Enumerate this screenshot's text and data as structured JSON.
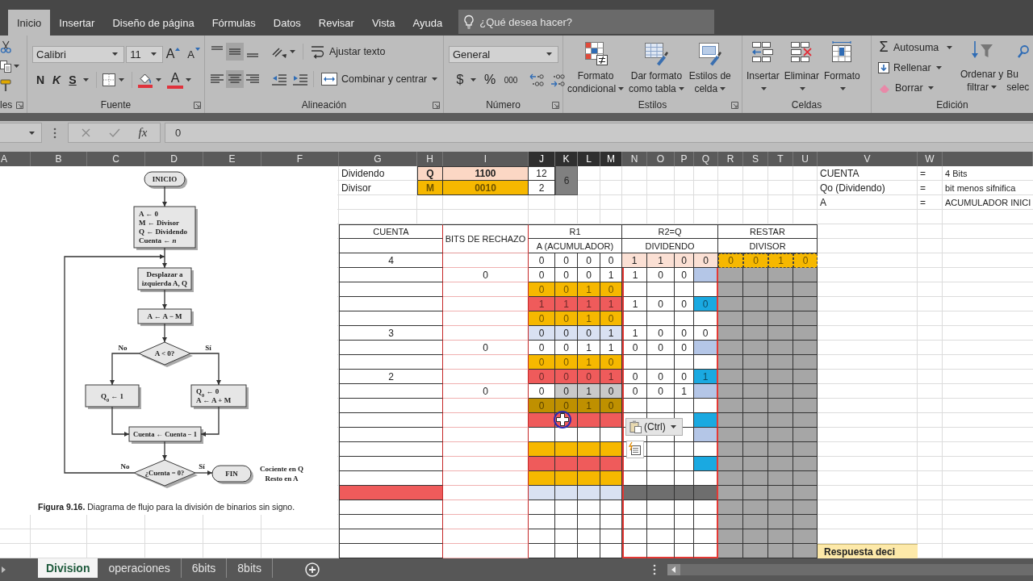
{
  "ribbon_tabs": [
    {
      "label": "Inicio",
      "selected": true
    },
    {
      "label": "Insertar",
      "selected": false
    },
    {
      "label": "Diseño de página",
      "selected": false
    },
    {
      "label": "Fórmulas",
      "selected": false
    },
    {
      "label": "Datos",
      "selected": false
    },
    {
      "label": "Revisar",
      "selected": false
    },
    {
      "label": "Vista",
      "selected": false
    },
    {
      "label": "Ayuda",
      "selected": false
    }
  ],
  "tell_me": {
    "placeholder": "¿Qué desea hacer?"
  },
  "ribbon": {
    "clipboard": {
      "label": "les"
    },
    "font": {
      "label": "Fuente",
      "font_name": "Calibri",
      "font_size": "11",
      "grow": "A",
      "shrink": "A",
      "bold": "N",
      "italic": "K",
      "underline": "S",
      "font_color": "A"
    },
    "alignment": {
      "label": "Alineación",
      "vertical": [
        {
          "selected": false
        },
        {
          "selected": true
        },
        {
          "selected": false
        }
      ],
      "horizontal": [
        {
          "selected": false
        },
        {
          "selected": true
        },
        {
          "selected": false
        }
      ],
      "wrap_text": "Ajustar texto",
      "merge": "Combinar y centrar"
    },
    "number": {
      "label": "Número",
      "format": "General",
      "currency": "$",
      "percent": "%",
      "thousands": "000"
    },
    "styles": {
      "label": "Estilos",
      "buttons": [
        [
          "Formato",
          "condicional"
        ],
        [
          "Dar formato",
          "como tabla"
        ],
        [
          "Estilos de",
          "celda"
        ]
      ]
    },
    "cells": {
      "label": "Celdas",
      "buttons": [
        "Insertar",
        "Eliminar",
        "Formato"
      ]
    },
    "editing": {
      "label": "Edición",
      "sigma": "Σ",
      "autosum": "Autosuma",
      "fill": "Rellenar",
      "clear": "Borrar",
      "sort": [
        "Ordenar y",
        "filtrar"
      ],
      "find": [
        "Bu",
        "selec"
      ]
    }
  },
  "formula_bar": {
    "fx": "fx",
    "value": "0"
  },
  "columns": [
    {
      "label": "A",
      "selected": false
    },
    {
      "label": "B",
      "selected": false
    },
    {
      "label": "C",
      "selected": false
    },
    {
      "label": "D",
      "selected": false
    },
    {
      "label": "E",
      "selected": false
    },
    {
      "label": "F",
      "selected": false
    },
    {
      "label": "G",
      "selected": false
    },
    {
      "label": "H",
      "selected": false
    },
    {
      "label": "I",
      "selected": false
    },
    {
      "label": "J",
      "selected": true
    },
    {
      "label": "K",
      "selected": true
    },
    {
      "label": "L",
      "selected": true
    },
    {
      "label": "M",
      "selected": true
    },
    {
      "label": "N",
      "selected": false
    },
    {
      "label": "O",
      "selected": false
    },
    {
      "label": "P",
      "selected": false
    },
    {
      "label": "Q",
      "selected": false
    },
    {
      "label": "R",
      "selected": false
    },
    {
      "label": "S",
      "selected": false
    },
    {
      "label": "T",
      "selected": false
    },
    {
      "label": "U",
      "selected": false
    },
    {
      "label": "V",
      "selected": false
    },
    {
      "label": "W",
      "selected": false
    }
  ],
  "flowchart": {
    "start": "INICIO",
    "init": [
      "A ← 0",
      "M ← Divisor",
      "Q ← Dividendo",
      "Cuenta ← *n*"
    ],
    "shift": [
      "Desplazar a",
      "izquierda A, Q"
    ],
    "subtract": "A ← A − M",
    "test": "A < 0?",
    "test_no": "No",
    "test_yes": "Sí",
    "set_one": "Q$_{0}$ ← 1",
    "restore": [
      "Q$_{0}$ ← 0",
      "A ← A + M"
    ],
    "decrement": "Cuenta ← Cuenta − 1",
    "loop_test": "¿Cuenta = 0?",
    "loop_no": "No",
    "loop_yes": "Sí",
    "end": "FIN",
    "result": [
      "Cociente en Q",
      "Resto en A"
    ],
    "caption": "**Figura 9.16.** Diagrama de flujo para la división de binarios sin signo."
  },
  "info": {
    "rows": [
      {
        "label": "Dividendo",
        "register": "Q",
        "binary": "1100",
        "decimal": "12",
        "color": "#fbd7c4"
      },
      {
        "label": "Divisor",
        "register": "M",
        "binary": "0010",
        "decimal": "2",
        "color": "#f6b800"
      }
    ],
    "quotient": "6"
  },
  "notes": [
    {
      "term": "CUENTA",
      "equals": "=",
      "meaning": "4 Bits"
    },
    {
      "term": "Qo (Dividendo)",
      "equals": "=",
      "meaning": "bit menos sifnifica"
    },
    {
      "term": "A",
      "equals": "=",
      "meaning": "ACUMULADOR INICI"
    }
  ],
  "table": {
    "cuenta": "CUENTA",
    "bits": "BITS DE RECHAZO",
    "r1": "R1",
    "r1_sub": "A (ACUMULADOR)",
    "r2": "R2=Q",
    "r2_sub": "DIVIDENDO",
    "restar": "RESTAR",
    "restar_sub": "DIVISOR",
    "restar_marquee": true,
    "rows": [
      {
        "cuenta": {
          "value": "4"
        },
        "a": [
          {
            "value": "0",
            "color": "#ffffff"
          },
          {
            "value": "0",
            "color": "#ffffff"
          },
          {
            "value": "0",
            "color": "#ffffff"
          },
          {
            "value": "0",
            "color": "#ffffff"
          }
        ],
        "q": [
          {
            "value": "1",
            "color": "#fbe0d4"
          },
          {
            "value": "1",
            "color": "#fbe0d4"
          },
          {
            "value": "0",
            "color": "#fbe0d4"
          },
          {
            "value": "0",
            "color": "#fbe0d4"
          }
        ],
        "m": [
          {
            "value": "0",
            "color": "#f6b800"
          },
          {
            "value": "0",
            "color": "#f6b800"
          },
          {
            "value": "1",
            "color": "#f6b800"
          },
          {
            "value": "0",
            "color": "#f6b800"
          }
        ]
      },
      {
        "bits": "0",
        "a": [
          {
            "value": "0",
            "color": "#ffffff"
          },
          {
            "value": "0",
            "color": "#ffffff"
          },
          {
            "value": "0",
            "color": "#ffffff"
          },
          {
            "value": "1",
            "color": "#ffffff"
          }
        ],
        "q": [
          {
            "value": "1",
            "color": "#ffffff"
          },
          {
            "value": "0",
            "color": "#ffffff"
          },
          {
            "value": "0",
            "color": "#ffffff"
          },
          {
            "color": "#b4c6e7"
          }
        ],
        "m": [
          {
            "color": "#a6a6a6"
          },
          {
            "color": "#a6a6a6"
          },
          {
            "color": "#a6a6a6"
          },
          {
            "color": "#a6a6a6"
          }
        ]
      },
      {
        "a": [
          {
            "value": "0",
            "color": "#f6b800"
          },
          {
            "value": "0",
            "color": "#f6b800"
          },
          {
            "value": "1",
            "color": "#f6b800"
          },
          {
            "value": "0",
            "color": "#f6b800"
          }
        ],
        "q": [
          {
            "color": "#ffffff"
          },
          {
            "color": "#ffffff"
          },
          {
            "color": "#ffffff"
          },
          {
            "color": "#ffffff"
          }
        ],
        "m": [
          {
            "color": "#a6a6a6"
          },
          {
            "color": "#a6a6a6"
          },
          {
            "color": "#a6a6a6"
          },
          {
            "color": "#a6a6a6"
          }
        ]
      },
      {
        "a": [
          {
            "value": "1",
            "color": "#ef5b5b"
          },
          {
            "value": "1",
            "color": "#ef5b5b"
          },
          {
            "value": "1",
            "color": "#ef5b5b"
          },
          {
            "value": "1",
            "color": "#ef5b5b"
          }
        ],
        "q": [
          {
            "value": "1",
            "color": "#ffffff"
          },
          {
            "value": "0",
            "color": "#ffffff"
          },
          {
            "value": "0",
            "color": "#ffffff"
          },
          {
            "value": "0",
            "color": "#1aa9e1"
          }
        ],
        "m": [
          {
            "color": "#a6a6a6"
          },
          {
            "color": "#a6a6a6"
          },
          {
            "color": "#a6a6a6"
          },
          {
            "color": "#a6a6a6"
          }
        ]
      },
      {
        "a": [
          {
            "value": "0",
            "color": "#f6b800"
          },
          {
            "value": "0",
            "color": "#f6b800"
          },
          {
            "value": "1",
            "color": "#f6b800"
          },
          {
            "value": "0",
            "color": "#f6b800"
          }
        ],
        "q": [
          {
            "color": "#ffffff"
          },
          {
            "color": "#ffffff"
          },
          {
            "color": "#ffffff"
          },
          {
            "color": "#ffffff"
          }
        ],
        "m": [
          {
            "color": "#a6a6a6"
          },
          {
            "color": "#a6a6a6"
          },
          {
            "color": "#a6a6a6"
          },
          {
            "color": "#a6a6a6"
          }
        ]
      },
      {
        "cuenta": {
          "value": "3"
        },
        "a": [
          {
            "value": "0",
            "color": "#d9e1f2"
          },
          {
            "value": "0",
            "color": "#d9e1f2"
          },
          {
            "value": "0",
            "color": "#d9e1f2"
          },
          {
            "value": "1",
            "color": "#d9e1f2"
          }
        ],
        "q": [
          {
            "value": "1",
            "color": "#ffffff"
          },
          {
            "value": "0",
            "color": "#ffffff"
          },
          {
            "value": "0",
            "color": "#ffffff"
          },
          {
            "value": "0",
            "color": "#ffffff"
          }
        ],
        "m": [
          {
            "color": "#a6a6a6"
          },
          {
            "color": "#a6a6a6"
          },
          {
            "color": "#a6a6a6"
          },
          {
            "color": "#a6a6a6"
          }
        ]
      },
      {
        "bits": "0",
        "a": [
          {
            "value": "0",
            "color": "#ffffff"
          },
          {
            "value": "0",
            "color": "#ffffff"
          },
          {
            "value": "1",
            "color": "#ffffff"
          },
          {
            "value": "1",
            "color": "#ffffff"
          }
        ],
        "q": [
          {
            "value": "0",
            "color": "#ffffff"
          },
          {
            "value": "0",
            "color": "#ffffff"
          },
          {
            "value": "0",
            "color": "#ffffff"
          },
          {
            "color": "#b4c6e7"
          }
        ],
        "m": [
          {
            "color": "#a6a6a6"
          },
          {
            "color": "#a6a6a6"
          },
          {
            "color": "#a6a6a6"
          },
          {
            "color": "#a6a6a6"
          }
        ]
      },
      {
        "a": [
          {
            "value": "0",
            "color": "#f6b800"
          },
          {
            "value": "0",
            "color": "#f6b800"
          },
          {
            "value": "1",
            "color": "#f6b800"
          },
          {
            "value": "0",
            "color": "#f6b800"
          }
        ],
        "q": [
          {
            "color": "#ffffff"
          },
          {
            "color": "#ffffff"
          },
          {
            "color": "#ffffff"
          },
          {
            "color": "#ffffff"
          }
        ],
        "m": [
          {
            "color": "#a6a6a6"
          },
          {
            "color": "#a6a6a6"
          },
          {
            "color": "#a6a6a6"
          },
          {
            "color": "#a6a6a6"
          }
        ]
      },
      {
        "cuenta": {
          "value": "2"
        },
        "a": [
          {
            "value": "0",
            "color": "#ef5b5b"
          },
          {
            "value": "0",
            "color": "#ef5b5b"
          },
          {
            "value": "0",
            "color": "#ef5b5b"
          },
          {
            "value": "1",
            "color": "#ef5b5b"
          }
        ],
        "q": [
          {
            "value": "0",
            "color": "#ffffff"
          },
          {
            "value": "0",
            "color": "#ffffff"
          },
          {
            "value": "0",
            "color": "#ffffff"
          },
          {
            "value": "1",
            "color": "#1aa9e1"
          }
        ],
        "m": [
          {
            "color": "#a6a6a6"
          },
          {
            "color": "#a6a6a6"
          },
          {
            "color": "#a6a6a6"
          },
          {
            "color": "#a6a6a6"
          }
        ]
      },
      {
        "bits": "0",
        "a": [
          {
            "value": "0",
            "color": "#ffffff"
          },
          {
            "value": "0",
            "color": "#c9c9c9"
          },
          {
            "value": "1",
            "color": "#c9c9c9"
          },
          {
            "value": "0",
            "color": "#c9c9c9"
          }
        ],
        "q": [
          {
            "value": "0",
            "color": "#ffffff"
          },
          {
            "value": "0",
            "color": "#ffffff"
          },
          {
            "value": "1",
            "color": "#ffffff"
          },
          {
            "color": "#b4c6e7"
          }
        ],
        "m": [
          {
            "color": "#a6a6a6"
          },
          {
            "color": "#a6a6a6"
          },
          {
            "color": "#a6a6a6"
          },
          {
            "color": "#a6a6a6"
          }
        ]
      },
      {
        "a": [
          {
            "value": "0",
            "color": "#bf9000"
          },
          {
            "value": "0",
            "color": "#bf9000"
          },
          {
            "value": "1",
            "color": "#bf9000"
          },
          {
            "value": "0",
            "color": "#bf9000"
          }
        ],
        "q": [
          {
            "color": "#ffffff"
          },
          {
            "color": "#ffffff"
          },
          {
            "color": "#ffffff"
          },
          {
            "color": "#ffffff"
          }
        ],
        "m": [
          {
            "color": "#a6a6a6"
          },
          {
            "color": "#a6a6a6"
          },
          {
            "color": "#a6a6a6"
          },
          {
            "color": "#a6a6a6"
          }
        ]
      },
      {
        "a": [
          {
            "color": "#ef5b5b"
          },
          {
            "color": "#ef5b5b"
          },
          {
            "color": "#ef5b5b"
          },
          {
            "color": "#ef5b5b"
          }
        ],
        "q": [
          {
            "color": "#ffffff"
          },
          {
            "color": "#ffffff"
          },
          {
            "color": "#ffffff"
          },
          {
            "color": "#1aa9e1"
          }
        ],
        "m": [
          {
            "color": "#a6a6a6"
          },
          {
            "color": "#a6a6a6"
          },
          {
            "color": "#a6a6a6"
          },
          {
            "color": "#a6a6a6"
          }
        ]
      },
      {
        "a": [
          {
            "color": "#ffffff"
          },
          {
            "color": "#ffffff"
          },
          {
            "color": "#ffffff"
          },
          {
            "color": "#ffffff"
          }
        ],
        "q": [
          {
            "color": "#ffffff"
          },
          {
            "color": "#ffffff"
          },
          {
            "color": "#ffffff"
          },
          {
            "color": "#b4c6e7"
          }
        ],
        "m": [
          {
            "color": "#a6a6a6"
          },
          {
            "color": "#a6a6a6"
          },
          {
            "color": "#a6a6a6"
          },
          {
            "color": "#a6a6a6"
          }
        ]
      },
      {
        "a": [
          {
            "color": "#f6b800"
          },
          {
            "color": "#f6b800"
          },
          {
            "color": "#f6b800"
          },
          {
            "color": "#f6b800"
          }
        ],
        "q": [
          {
            "color": "#ffffff"
          },
          {
            "color": "#ffffff"
          },
          {
            "color": "#ffffff"
          },
          {
            "color": "#ffffff"
          }
        ],
        "m": [
          {
            "color": "#a6a6a6"
          },
          {
            "color": "#a6a6a6"
          },
          {
            "color": "#a6a6a6"
          },
          {
            "color": "#a6a6a6"
          }
        ]
      },
      {
        "a": [
          {
            "color": "#ef5b5b"
          },
          {
            "color": "#ef5b5b"
          },
          {
            "color": "#ef5b5b"
          },
          {
            "color": "#ef5b5b"
          }
        ],
        "q": [
          {
            "color": "#ffffff"
          },
          {
            "color": "#ffffff"
          },
          {
            "color": "#ffffff"
          },
          {
            "color": "#1aa9e1"
          }
        ],
        "m": [
          {
            "color": "#a6a6a6"
          },
          {
            "color": "#a6a6a6"
          },
          {
            "color": "#a6a6a6"
          },
          {
            "color": "#a6a6a6"
          }
        ]
      },
      {
        "a": [
          {
            "color": "#f6b800"
          },
          {
            "color": "#f6b800"
          },
          {
            "color": "#f6b800"
          },
          {
            "color": "#f6b800"
          }
        ],
        "q": [
          {
            "color": "#ffffff"
          },
          {
            "color": "#ffffff"
          },
          {
            "color": "#ffffff"
          },
          {
            "color": "#ffffff"
          }
        ],
        "m": [
          {
            "color": "#a6a6a6"
          },
          {
            "color": "#a6a6a6"
          },
          {
            "color": "#a6a6a6"
          },
          {
            "color": "#a6a6a6"
          }
        ]
      },
      {
        "cuenta": {
          "color": "#ef5b5b"
        },
        "a": [
          {
            "color": "#d9e1f2"
          },
          {
            "color": "#d9e1f2"
          },
          {
            "color": "#d9e1f2"
          },
          {
            "color": "#d9e1f2"
          }
        ],
        "q": [
          {
            "color": "#6e6e6e"
          },
          {
            "color": "#6e6e6e"
          },
          {
            "color": "#6e6e6e"
          },
          {
            "color": "#6e6e6e"
          }
        ],
        "m": [
          {
            "color": "#a6a6a6"
          },
          {
            "color": "#a6a6a6"
          },
          {
            "color": "#a6a6a6"
          },
          {
            "color": "#a6a6a6"
          }
        ]
      },
      {
        "a": [
          {
            "color": "#ffffff"
          },
          {
            "color": "#ffffff"
          },
          {
            "color": "#ffffff"
          },
          {
            "color": "#ffffff"
          }
        ],
        "q": [
          {
            "color": "#ffffff"
          },
          {
            "color": "#ffffff"
          },
          {
            "color": "#ffffff"
          },
          {
            "color": "#ffffff"
          }
        ],
        "m": [
          {
            "color": "#a6a6a6"
          },
          {
            "color": "#a6a6a6"
          },
          {
            "color": "#a6a6a6"
          },
          {
            "color": "#a6a6a6"
          }
        ]
      },
      {
        "a": [
          {
            "color": "#ffffff"
          },
          {
            "color": "#ffffff"
          },
          {
            "color": "#ffffff"
          },
          {
            "color": "#ffffff"
          }
        ],
        "q": [
          {
            "color": "#ffffff"
          },
          {
            "color": "#ffffff"
          },
          {
            "color": "#ffffff"
          },
          {
            "color": "#ffffff"
          }
        ],
        "m": [
          {
            "color": "#a6a6a6"
          },
          {
            "color": "#a6a6a6"
          },
          {
            "color": "#a6a6a6"
          },
          {
            "color": "#a6a6a6"
          }
        ]
      },
      {
        "a": [
          {
            "color": "#ffffff"
          },
          {
            "color": "#ffffff"
          },
          {
            "color": "#ffffff"
          },
          {
            "color": "#ffffff"
          }
        ],
        "q": [
          {
            "color": "#ffffff"
          },
          {
            "color": "#ffffff"
          },
          {
            "color": "#ffffff"
          },
          {
            "color": "#ffffff"
          }
        ],
        "m": [
          {
            "color": "#a6a6a6"
          },
          {
            "color": "#a6a6a6"
          },
          {
            "color": "#a6a6a6"
          },
          {
            "color": "#a6a6a6"
          }
        ]
      },
      {
        "a": [
          {
            "color": "#ffffff"
          },
          {
            "color": "#ffffff"
          },
          {
            "color": "#ffffff"
          },
          {
            "color": "#ffffff"
          }
        ],
        "q": [
          {
            "color": "#ffffff"
          },
          {
            "color": "#ffffff"
          },
          {
            "color": "#ffffff"
          },
          {
            "color": "#ffffff"
          }
        ],
        "m": [
          {
            "color": "#a6a6a6"
          },
          {
            "color": "#a6a6a6"
          },
          {
            "color": "#a6a6a6"
          },
          {
            "color": "#a6a6a6"
          }
        ]
      }
    ]
  },
  "answer_label": "Respuesta deci",
  "paste_options": {
    "label": "(Ctrl)"
  },
  "sheets": [
    {
      "label": "Division",
      "selected": true
    },
    {
      "label": "operaciones",
      "selected": false
    },
    {
      "label": "6bits",
      "selected": false
    },
    {
      "label": "8bits",
      "selected": false
    }
  ]
}
